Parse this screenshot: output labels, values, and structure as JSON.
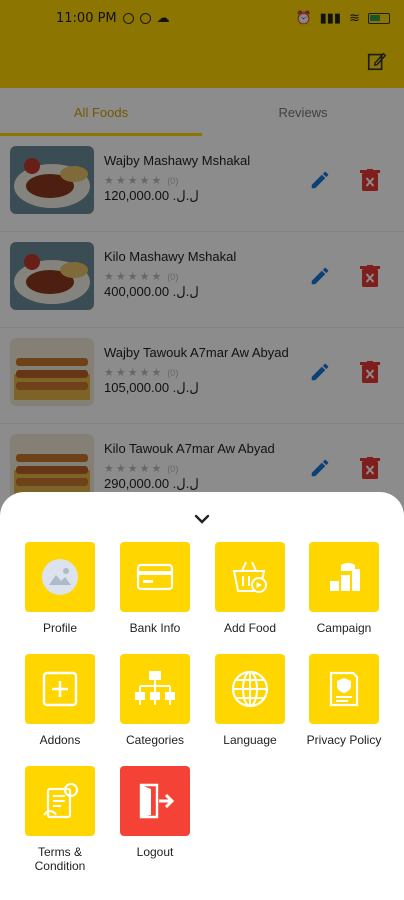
{
  "status_bar": {
    "time": "11:00 PM",
    "battery": "54"
  },
  "tabs": [
    {
      "label": "All Foods"
    },
    {
      "label": "Reviews"
    }
  ],
  "foods": [
    {
      "name": "Wajby Mashawy Mshakal",
      "rating_count": "(0)",
      "price": "120,000.00 .ل.ل"
    },
    {
      "name": "Kilo Mashawy Mshakal",
      "rating_count": "(0)",
      "price": "400,000.00 .ل.ل"
    },
    {
      "name": "Wajby Tawouk A7mar Aw Abyad",
      "rating_count": "(0)",
      "price": "105,000.00 .ل.ل"
    },
    {
      "name": "Kilo Tawouk A7mar Aw Abyad",
      "rating_count": "(0)",
      "price": "290,000.00 .ل.ل"
    }
  ],
  "menu": [
    {
      "label": "Profile",
      "icon": "profile-icon"
    },
    {
      "label": "Bank Info",
      "icon": "card-icon"
    },
    {
      "label": "Add Food",
      "icon": "basket-icon"
    },
    {
      "label": "Campaign",
      "icon": "campaign-icon"
    },
    {
      "label": "Addons",
      "icon": "plus-box-icon"
    },
    {
      "label": "Categories",
      "icon": "hierarchy-icon"
    },
    {
      "label": "Language",
      "icon": "globe-icon"
    },
    {
      "label": "Privacy Policy",
      "icon": "policy-icon"
    },
    {
      "label": "Terms & Condition",
      "icon": "terms-icon"
    },
    {
      "label": "Logout",
      "icon": "logout-icon"
    }
  ],
  "colors": {
    "brand": "#ffd600",
    "edit": "#1976d2",
    "delete": "#e53935",
    "logout": "#f44336"
  }
}
